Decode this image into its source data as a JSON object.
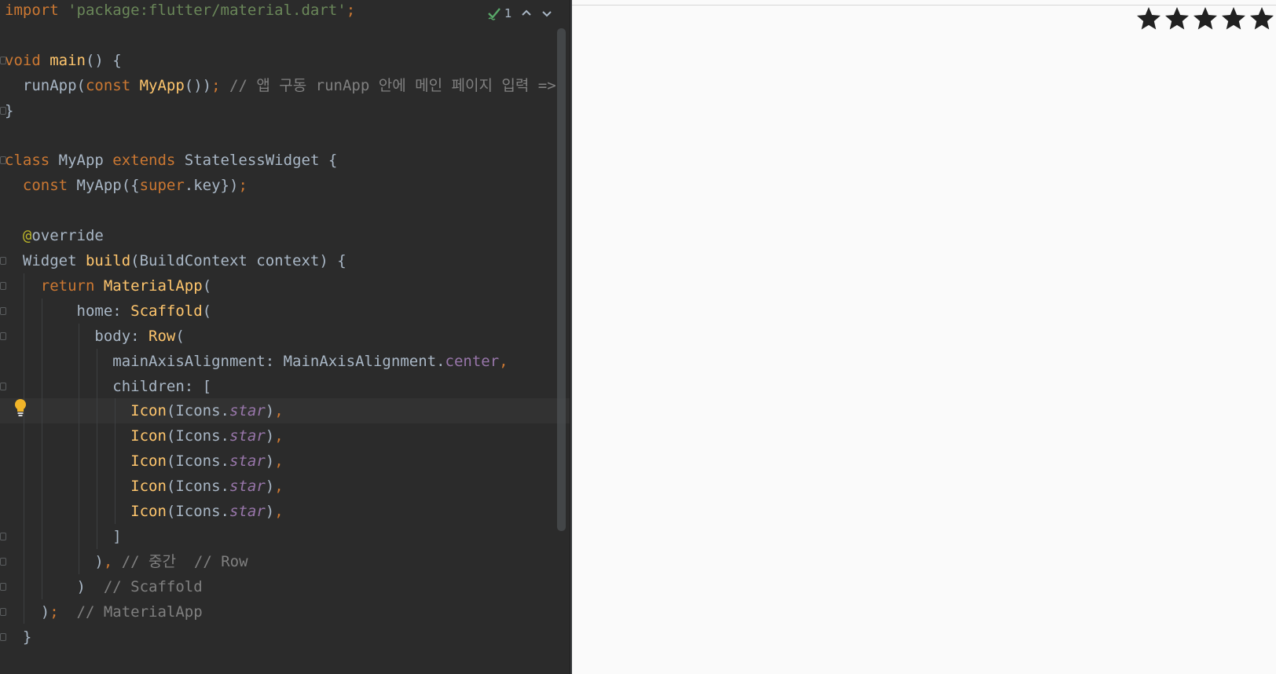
{
  "editor": {
    "inspection": {
      "check_count": "1",
      "icons": [
        "check-icon",
        "chevron-up-icon",
        "chevron-down-icon"
      ]
    },
    "lines": [
      [
        {
          "t": "import ",
          "c": "kw"
        },
        {
          "t": "'package:flutter/material.dart'",
          "c": "str"
        },
        {
          "t": ";",
          "c": "kw"
        }
      ],
      [],
      [
        {
          "t": "void ",
          "c": "kw"
        },
        {
          "t": "main",
          "c": "fn"
        },
        {
          "t": "() {",
          "c": "def"
        }
      ],
      [
        {
          "t": "  runApp(",
          "c": "def"
        },
        {
          "t": "const ",
          "c": "kw"
        },
        {
          "t": "MyApp",
          "c": "fn"
        },
        {
          "t": "())",
          "c": "def"
        },
        {
          "t": "; ",
          "c": "kw"
        },
        {
          "t": "// 앱 구동 runApp 안에 메인 페이지 입력 =>",
          "c": "cm"
        }
      ],
      [
        {
          "t": "}",
          "c": "def"
        }
      ],
      [],
      [
        {
          "t": "class ",
          "c": "kw"
        },
        {
          "t": "MyApp ",
          "c": "def"
        },
        {
          "t": "extends ",
          "c": "kw"
        },
        {
          "t": "StatelessWidget {",
          "c": "def"
        }
      ],
      [
        {
          "t": "  const ",
          "c": "kw"
        },
        {
          "t": "MyApp({",
          "c": "def"
        },
        {
          "t": "super",
          "c": "kw"
        },
        {
          "t": ".key})",
          "c": "def"
        },
        {
          "t": ";",
          "c": "kw"
        }
      ],
      [],
      [
        {
          "t": "  ",
          "c": "def"
        },
        {
          "t": "@",
          "c": "ann"
        },
        {
          "t": "override",
          "c": "def"
        }
      ],
      [
        {
          "t": "  Widget ",
          "c": "def"
        },
        {
          "t": "build",
          "c": "fn"
        },
        {
          "t": "(BuildContext context) {",
          "c": "def"
        }
      ],
      [
        {
          "t": "    return ",
          "c": "kw"
        },
        {
          "t": "MaterialApp",
          "c": "fn"
        },
        {
          "t": "(",
          "c": "def"
        }
      ],
      [
        {
          "t": "        home: ",
          "c": "def"
        },
        {
          "t": "Scaffold",
          "c": "fn"
        },
        {
          "t": "(",
          "c": "def"
        }
      ],
      [
        {
          "t": "          body: ",
          "c": "def"
        },
        {
          "t": "Row",
          "c": "fn"
        },
        {
          "t": "(",
          "c": "def"
        }
      ],
      [
        {
          "t": "            mainAxisAlignment: MainAxisAlignment.",
          "c": "def"
        },
        {
          "t": "center",
          "c": "purple"
        },
        {
          "t": ",",
          "c": "kw"
        }
      ],
      [
        {
          "t": "            children: [",
          "c": "def"
        }
      ],
      [
        {
          "t": "              ",
          "c": "def"
        },
        {
          "t": "Icon",
          "c": "fn"
        },
        {
          "t": "(Icons.",
          "c": "def"
        },
        {
          "t": "star",
          "c": "field"
        },
        {
          "t": ")",
          "c": "def"
        },
        {
          "t": ",",
          "c": "kw"
        }
      ],
      [
        {
          "t": "              ",
          "c": "def"
        },
        {
          "t": "Icon",
          "c": "fn"
        },
        {
          "t": "(Icons.",
          "c": "def"
        },
        {
          "t": "star",
          "c": "field"
        },
        {
          "t": ")",
          "c": "def"
        },
        {
          "t": ",",
          "c": "kw"
        }
      ],
      [
        {
          "t": "              ",
          "c": "def"
        },
        {
          "t": "Icon",
          "c": "fn"
        },
        {
          "t": "(Icons.",
          "c": "def"
        },
        {
          "t": "star",
          "c": "field"
        },
        {
          "t": ")",
          "c": "def"
        },
        {
          "t": ",",
          "c": "kw"
        }
      ],
      [
        {
          "t": "              ",
          "c": "def"
        },
        {
          "t": "Icon",
          "c": "fn"
        },
        {
          "t": "(Icons.",
          "c": "def"
        },
        {
          "t": "star",
          "c": "field"
        },
        {
          "t": ")",
          "c": "def"
        },
        {
          "t": ",",
          "c": "kw"
        }
      ],
      [
        {
          "t": "              ",
          "c": "def"
        },
        {
          "t": "Icon",
          "c": "fn"
        },
        {
          "t": "(Icons.",
          "c": "def"
        },
        {
          "t": "star",
          "c": "field"
        },
        {
          "t": ")",
          "c": "def"
        },
        {
          "t": ",",
          "c": "kw"
        }
      ],
      [
        {
          "t": "            ]",
          "c": "def"
        }
      ],
      [
        {
          "t": "          )",
          "c": "def"
        },
        {
          "t": ", ",
          "c": "kw"
        },
        {
          "t": "// 중간  // Row",
          "c": "cm"
        }
      ],
      [
        {
          "t": "        )  ",
          "c": "def"
        },
        {
          "t": "// Scaffold",
          "c": "cm"
        }
      ],
      [
        {
          "t": "    )",
          "c": "def"
        },
        {
          "t": ";  ",
          "c": "kw"
        },
        {
          "t": "// MaterialApp",
          "c": "cm"
        }
      ],
      [
        {
          "t": "  }",
          "c": "def"
        }
      ]
    ],
    "highlight_line": 16,
    "colors": {
      "background": "#2b2b2b",
      "keyword": "#cc7832",
      "string": "#6a8759",
      "function": "#ffc66d",
      "comment": "#808080",
      "field": "#9876aa"
    }
  },
  "preview": {
    "stars": [
      "star-icon",
      "star-icon",
      "star-icon",
      "star-icon",
      "star-icon"
    ],
    "star_color": "#212121"
  }
}
